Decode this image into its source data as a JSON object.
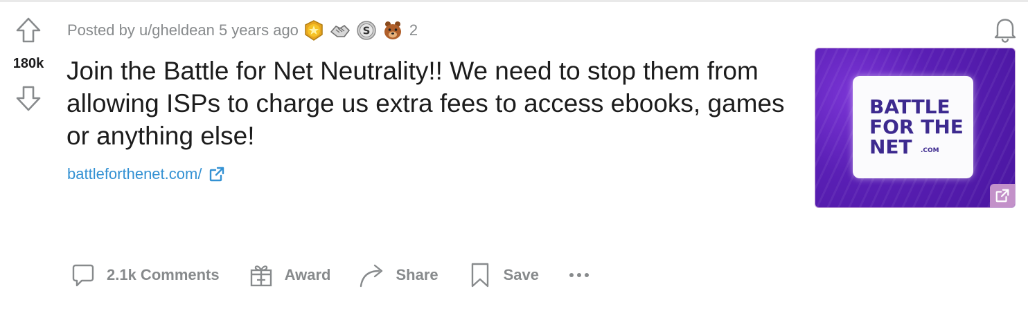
{
  "post": {
    "score": "180k",
    "meta": {
      "posted_by": "Posted by u/gheldean 5 years ago",
      "awards": [
        {
          "icon": "gold-award-icon",
          "color": "#f6c327"
        },
        {
          "icon": "wholesome-handshake-award-icon",
          "color": "#c9c9c9"
        },
        {
          "icon": "silver-award-icon",
          "color": "#c0c0c0"
        },
        {
          "icon": "bear-award-icon",
          "color": "#b05f2a"
        }
      ],
      "award_count": "2"
    },
    "title": "Join the Battle for Net Neutrality!! We need to stop them from allowing ISPs to charge us extra fees to access ebooks, games or anything else!",
    "link": {
      "text": "battleforthenet.com/",
      "icon": "external-link-icon",
      "color": "#3391d3"
    },
    "thumbnail": {
      "logo_text": "BATTLE\nFOR THE\nNET",
      "logo_suffix": ".COM",
      "badge_icon": "external-link-icon"
    }
  },
  "actions": {
    "comments_label": "2.1k Comments",
    "award_label": "Award",
    "share_label": "Share",
    "save_label": "Save"
  }
}
